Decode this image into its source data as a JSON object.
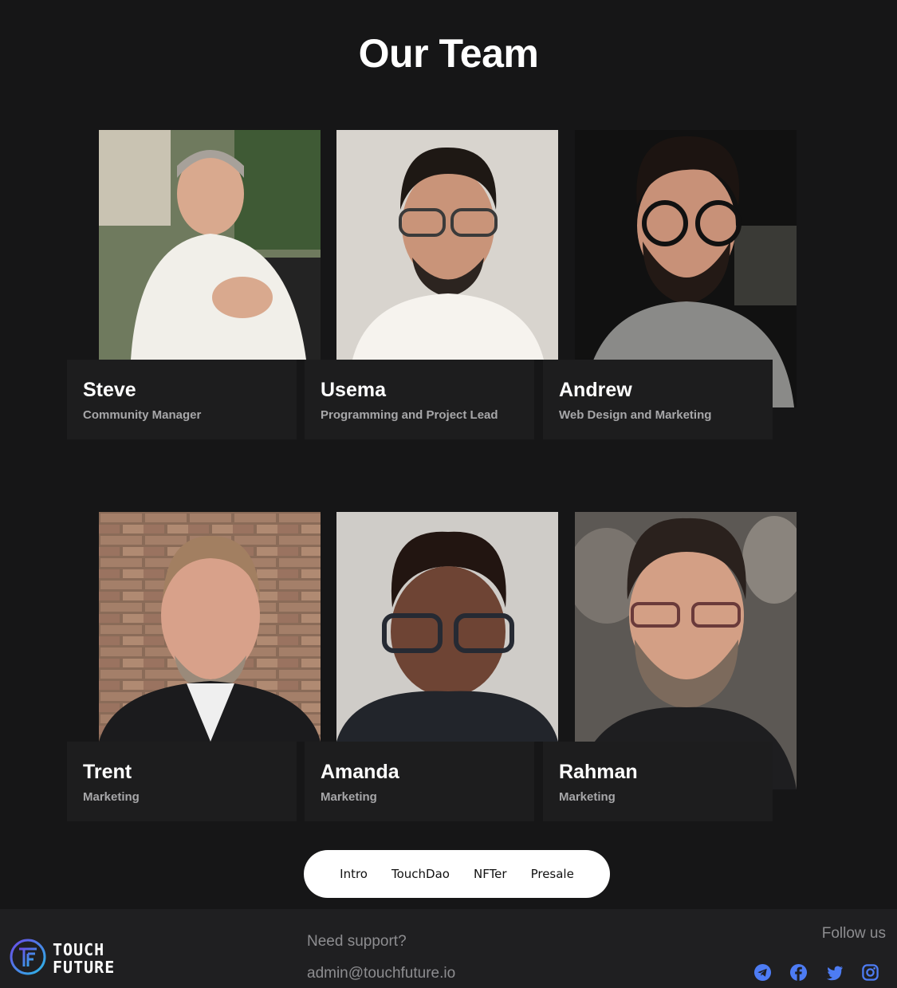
{
  "title": "Our Team",
  "team": [
    {
      "name": "Steve",
      "role": "Community Manager"
    },
    {
      "name": "Usema",
      "role": "Programming and Project Lead"
    },
    {
      "name": "Andrew",
      "role": "Web Design and Marketing"
    },
    {
      "name": "Trent",
      "role": "Marketing"
    },
    {
      "name": "Amanda",
      "role": "Marketing"
    },
    {
      "name": "Rahman",
      "role": "Marketing"
    }
  ],
  "nav": [
    "Intro",
    "TouchDao",
    "NFTer",
    "Presale"
  ],
  "footer": {
    "logo_text_top": "TOUCH",
    "logo_text_bottom": "FUTURE",
    "support_label": "Need support?",
    "support_email": "admin@touchfuture.io",
    "follow_label": "Follow us",
    "social_icons": [
      "telegram-icon",
      "facebook-icon",
      "twitter-icon",
      "instagram-icon"
    ]
  },
  "colors": {
    "background": "#161617",
    "card": "#1d1d1e",
    "footer": "#1f1f21",
    "social_accent": "#4d7cf4"
  }
}
